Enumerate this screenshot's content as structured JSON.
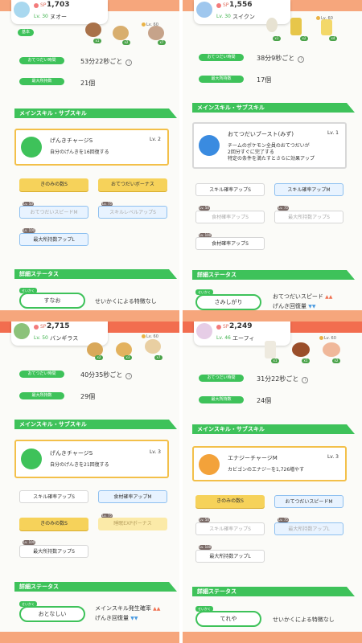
{
  "panels": [
    {
      "power": "1,703",
      "level": "Lv. 30",
      "name": "ヌオー",
      "ingredient_levels": [
        "Lv. 60"
      ],
      "ingredient_counts": [
        "x1",
        "x2",
        "x7"
      ],
      "first_label": "基本",
      "help_interval_label": "おてつだい時間",
      "help_interval": "53分22秒ごと",
      "max_carry_label": "最大所持数",
      "max_carry": "21個",
      "section_skills": "メインスキル・サブスキル",
      "main_skill": {
        "name": "げんきチャージS",
        "level": "Lv. 2",
        "desc": "自分のげんきを16回復する"
      },
      "subskills": [
        {
          "label": "きのみの数S",
          "lv": ""
        },
        {
          "label": "おてつだいボーナス",
          "lv": ""
        },
        {
          "label": "おてつだいスピードM",
          "lv": "Lv. 50"
        },
        {
          "label": "スキルレベルアップS",
          "lv": "Lv. 75"
        },
        {
          "label": "最大所持数アップL",
          "lv": "Lv. 100"
        }
      ],
      "section_detail": "詳細ステータス",
      "nature_tag": "せいかく",
      "nature": "すなお",
      "nature_effect": "せいかくによる特徴なし"
    },
    {
      "power": "1,556",
      "level": "Lv. 30",
      "name": "スイクン",
      "ingredient_levels": [
        "Lv. 60"
      ],
      "ingredient_counts": [
        "x1",
        "x2",
        "x4"
      ],
      "help_interval_label": "おてつだい時間",
      "help_interval": "38分9秒ごと",
      "max_carry_label": "最大所持数",
      "max_carry": "17個",
      "section_skills": "メインスキル・サブスキル",
      "main_skill": {
        "name": "おてつだいブースト(みず)",
        "level": "Lv. 1",
        "desc1": "チームのポケモン全員のおてつだいが",
        "desc2": "2回分すぐに完了する",
        "desc3": "特定の条件を満たすとさらに効果アップ"
      },
      "subskills": [
        {
          "label": "スキル確率アップS",
          "lv": ""
        },
        {
          "label": "スキル確率アップM",
          "lv": ""
        },
        {
          "label": "食材確率アップS",
          "lv": "Lv. 50"
        },
        {
          "label": "最大所持数アップS",
          "lv": "Lv. 75"
        },
        {
          "label": "食材確率アップS",
          "lv": "Lv. 100"
        }
      ],
      "section_detail": "詳細ステータス",
      "nature_tag": "せいかく",
      "nature": "さみしがり",
      "nature_effect1": "おてつだいスピード",
      "nature_effect2": "げんき回復量"
    },
    {
      "power": "2,715",
      "level": "Lv. 50",
      "name": "バンギラス",
      "ingredient_levels": [
        "Lv. 60"
      ],
      "ingredient_counts": [
        "x2",
        "x3",
        "x7"
      ],
      "help_interval_label": "おてつだい時間",
      "help_interval": "40分35秒ごと",
      "max_carry_label": "最大所持数",
      "max_carry": "29個",
      "section_skills": "メインスキル・サブスキル",
      "main_skill": {
        "name": "げんきチャージS",
        "level": "Lv. 3",
        "desc": "自分のげんきを21回復する"
      },
      "subskills": [
        {
          "label": "スキル確率アップS",
          "lv": ""
        },
        {
          "label": "食材確率アップM",
          "lv": ""
        },
        {
          "label": "きのみの数S",
          "lv": ""
        },
        {
          "label": "睡眠EXPボーナス",
          "lv": "Lv. 75"
        },
        {
          "label": "最大所持数アップS",
          "lv": "Lv. 100"
        }
      ],
      "section_detail": "詳細ステータス",
      "nature_tag": "せいかく",
      "nature": "おとなしい",
      "nature_effect1": "メインスキル発生確率",
      "nature_effect2": "げんき回復量"
    },
    {
      "power": "2,249",
      "level": "Lv. 46",
      "name": "エーフィ",
      "ingredient_levels": [
        "Lv. 60"
      ],
      "ingredient_counts": [
        "x1",
        "x1",
        "x2"
      ],
      "help_interval_label": "おてつだい時間",
      "help_interval": "31分22秒ごと",
      "max_carry_label": "最大所持数",
      "max_carry": "24個",
      "section_skills": "メインスキル・サブスキル",
      "main_skill": {
        "name": "エナジーチャージM",
        "level": "Lv. 3",
        "desc": "カビゴンのエナジーを1,726増やす"
      },
      "subskills": [
        {
          "label": "きのみの数S",
          "lv": ""
        },
        {
          "label": "おてつだいスピードM",
          "lv": ""
        },
        {
          "label": "スキル確率アップS",
          "lv": "Lv. 50"
        },
        {
          "label": "最大所持数アップL",
          "lv": "Lv. 75"
        },
        {
          "label": "最大所持数アップL",
          "lv": "Lv. 100"
        }
      ],
      "section_detail": "詳細ステータス",
      "nature_tag": "せいかく",
      "nature": "てれや",
      "nature_effect": "せいかくによる特徴なし"
    }
  ],
  "colors": {
    "green": "#3ec25a",
    "gold": "#f6d25a",
    "blue": "#8ec0f0",
    "orange": "#f6a67c"
  },
  "icons": {
    "up": "▲▲",
    "down": "▼▼"
  }
}
